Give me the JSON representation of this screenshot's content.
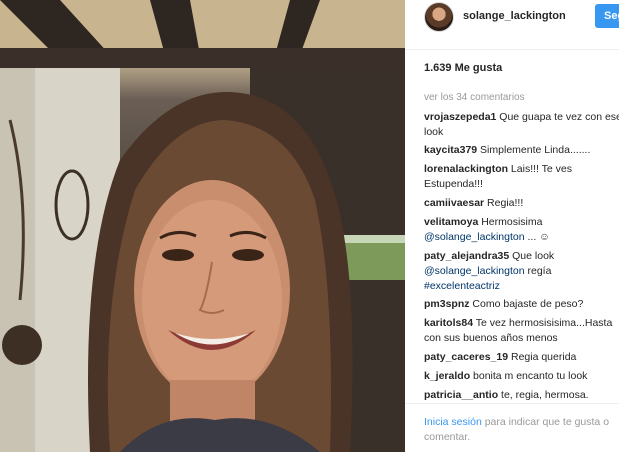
{
  "post": {
    "username": "solange_lackington",
    "follow_label": "Seguir",
    "likes": "1.639 Me gusta",
    "view_comments": "ver los 34 comentarios"
  },
  "comments": [
    {
      "author": "vrojaszepeda1",
      "text": " Que guapa te vez con ese look"
    },
    {
      "author": "kaycita379",
      "text": " Simplemente Linda......."
    },
    {
      "author": "lorenalackington",
      "text": " Lais!!! Te ves Estupenda!!!"
    },
    {
      "author": "camiivaesar",
      "text": " Regia!!!"
    },
    {
      "author": "velitamoya",
      "text": " Hermosisima ",
      "mention": "@solange_lackington",
      "suffix": " ... ☺"
    },
    {
      "author": "paty_alejandra35",
      "text": " Que look ",
      "mention": "@solange_lackington",
      "suffix": " regía ",
      "hashtag": "#excelenteactriz"
    },
    {
      "author": "pm3spnz",
      "text": " Como bajaste de peso?"
    },
    {
      "author": "karitols84",
      "text": " Te vez hermosisisima...Hasta con sus buenos años menos"
    },
    {
      "author": "paty_caceres_19",
      "text": " Regia querida"
    },
    {
      "author": "k_jeraldo",
      "text": " bonita m encanto tu look"
    },
    {
      "author": "patricia__antio",
      "text": " te, regia, hermosa."
    }
  ],
  "footer": {
    "login_label": "Inicia sesión",
    "rest": " para indicar que te gusta o comentar."
  },
  "colors": {
    "accent": "#3897f0",
    "mention": "#003569",
    "muted": "#999999"
  }
}
